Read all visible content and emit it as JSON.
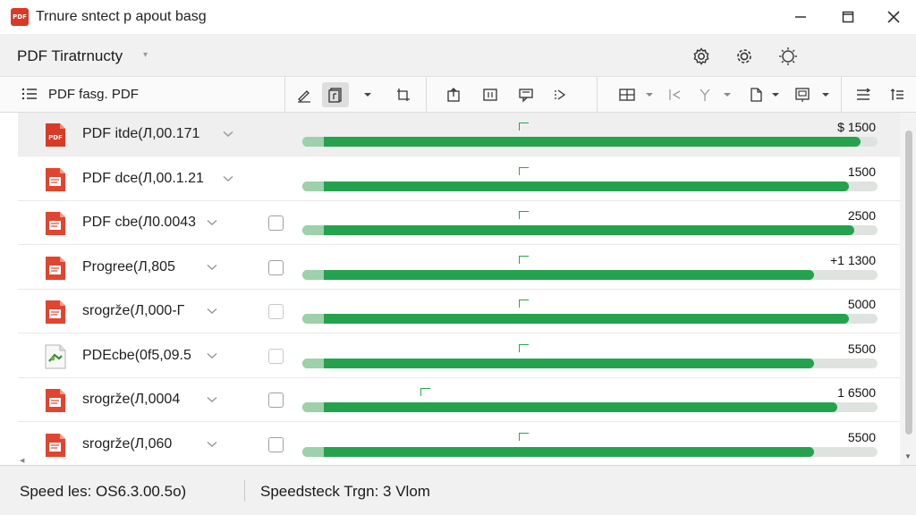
{
  "window": {
    "logo_text": "PDF",
    "title": "Trnure sntect p apout basg"
  },
  "header": {
    "title": "PDF Tiratrnucty",
    "icons": [
      "settings-gear-icon",
      "settings-cog-icon",
      "brightness-icon"
    ]
  },
  "toolbar": {
    "document_label": "PDF fasg. PDF"
  },
  "files": [
    {
      "name": "PDF itde(Л,00.171",
      "value": "$ 1500",
      "progress": 0.97,
      "checkbox": "none",
      "selected": true,
      "icon": "pdf"
    },
    {
      "name": "PDF dce(Л,00.1.21",
      "value": "1500",
      "progress": 0.95,
      "checkbox": "none",
      "selected": false,
      "icon": "doc"
    },
    {
      "name": "PDF cbe(Л0.0043",
      "value": "2500",
      "progress": 0.96,
      "checkbox": "empty",
      "selected": false,
      "icon": "doc"
    },
    {
      "name": "Progree(Л,805",
      "value": "+1 1300",
      "progress": 0.89,
      "checkbox": "empty",
      "selected": false,
      "icon": "doc"
    },
    {
      "name": "srogrže(Л,000-Г",
      "value": "5000",
      "progress": 0.95,
      "checkbox": "dim",
      "selected": false,
      "icon": "doc"
    },
    {
      "name": "PDEcbe(0f5,09.5",
      "value": "5500",
      "progress": 0.89,
      "checkbox": "dim",
      "selected": false,
      "icon": "image"
    },
    {
      "name": "srogrže(Л,0004",
      "value": "1 6500",
      "progress": 0.93,
      "checkbox": "empty",
      "selected": false,
      "icon": "doc"
    },
    {
      "name": "srogrže(Л,060",
      "value": "5500",
      "progress": 0.89,
      "checkbox": "empty",
      "selected": false,
      "icon": "doc"
    }
  ],
  "status": {
    "left": "Speed les: OS6.3.00.5o)",
    "right": "Speedsteck Trgn: 3 Vlom"
  },
  "colors": {
    "accent_green": "#25a24e",
    "pdf_red": "#d93a26"
  }
}
